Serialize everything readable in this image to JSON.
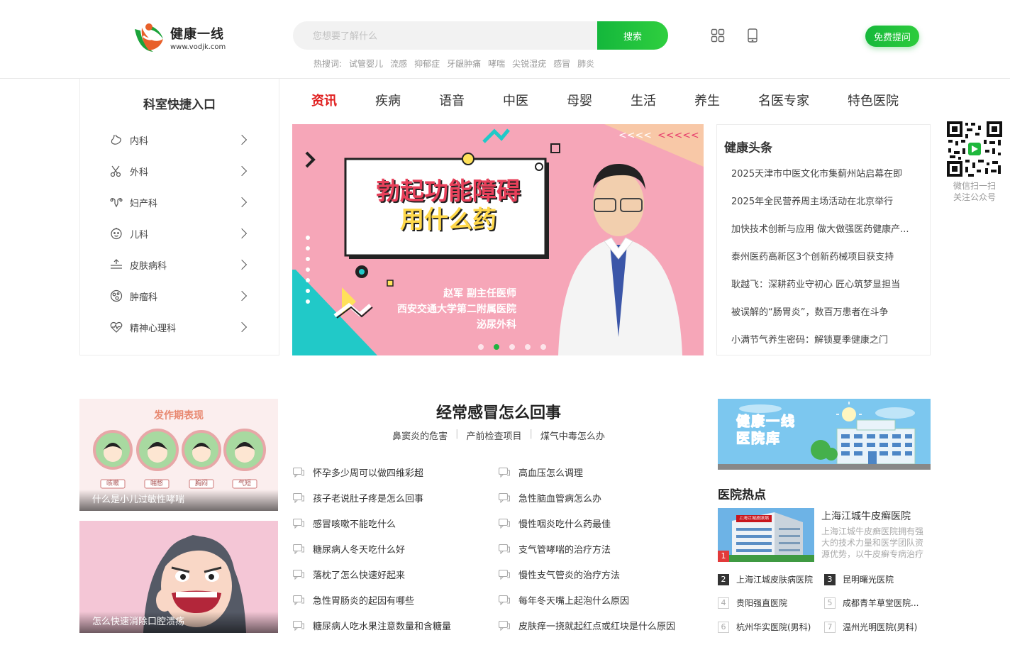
{
  "brand": {
    "name": "健康一线",
    "url": "www.vodjk.com"
  },
  "search": {
    "placeholder": "您想要了解什么",
    "button": "搜索"
  },
  "hot_searches": {
    "label": "热搜词:",
    "terms": [
      "试管婴儿",
      "流感",
      "抑郁症",
      "牙龈肿痛",
      "哮喘",
      "尖锐湿疣",
      "感冒",
      "肺炎"
    ]
  },
  "header": {
    "ask_button": "免费提问"
  },
  "sidebar": {
    "title": "科室快捷入口",
    "items": [
      {
        "label": "内科",
        "icon": "stomach-icon"
      },
      {
        "label": "外科",
        "icon": "scissors-icon"
      },
      {
        "label": "妇产科",
        "icon": "uterus-icon"
      },
      {
        "label": "儿科",
        "icon": "baby-face-icon"
      },
      {
        "label": "皮肤病科",
        "icon": "skin-layers-icon"
      },
      {
        "label": "肿瘤科",
        "icon": "cell-icon"
      },
      {
        "label": "精神心理科",
        "icon": "heartbeat-icon"
      }
    ]
  },
  "nav": {
    "items": [
      "资讯",
      "疾病",
      "语音",
      "中医",
      "母婴",
      "生活",
      "养生",
      "名医专家",
      "特色医院"
    ],
    "active": "资讯"
  },
  "banner": {
    "headline_line1": "勃起功能障碍",
    "headline_line2": "用什么药",
    "doctor": "赵军 副主任医师",
    "hospital": "西安交通大学第二附属医院",
    "department": "泌尿外科",
    "slides": 5,
    "active_slide": 2
  },
  "headlines": {
    "title": "健康头条",
    "items": [
      "2025天津市中医文化市集蓟州站启幕在即",
      "2025年全民营养周主场活动在北京举行",
      "加快技术创新与应用 做大做强医药健康产...",
      "泰州医药高新区3个创新药械项目获支持",
      "耿越飞：深耕药业守初心 匠心筑梦显担当",
      "被误解的“肠胃炎”，数百万患者在斗争",
      "小满节气养生密码：解锁夏季健康之门"
    ]
  },
  "qr": {
    "caption_line1": "微信扫一扫",
    "caption_line2": "关注公众号"
  },
  "thumbs": [
    {
      "caption": "什么是小儿过敏性哮喘",
      "title": "发作期表现",
      "tags": [
        "咳嗽",
        "喘憋",
        "胸闷",
        "气短"
      ]
    },
    {
      "caption": "怎么快速消除口腔溃疡"
    }
  ],
  "topic": {
    "title": "经常感冒怎么回事",
    "links": [
      "鼻窦炎的危害",
      "产前检查项目",
      "煤气中毒怎么办"
    ],
    "left": [
      "怀孕多少周可以做四维彩超",
      "孩子老说肚子疼是怎么回事",
      "感冒咳嗽不能吃什么",
      "糖尿病人冬天吃什么好",
      "落枕了怎么快速好起来",
      "急性胃肠炎的起因有哪些",
      "糖尿病人吃水果注意数量和含糖量"
    ],
    "right": [
      "高血压怎么调理",
      "急性脑血管病怎么办",
      "慢性咽炎吃什么药最佳",
      "支气管哮喘的治疗方法",
      "慢性支气管炎的治疗方法",
      "每年冬天嘴上起泡什么原因",
      "皮肤痒一挠就起红点或红块是什么原因"
    ]
  },
  "hospital_banner": {
    "line1": "健康一线",
    "line2": "医院库"
  },
  "hospital_hot": {
    "title": "医院热点",
    "featured": {
      "rank": "1",
      "name": "上海江城牛皮癣医院",
      "desc": "上海江城牛皮癣医院拥有强大的技术力量和医学团队资源优势，以牛皮癣专病治疗",
      "sign": "上海江城皮肤病医院"
    },
    "ranks": [
      {
        "num": "2",
        "name": "上海江城皮肤病医院"
      },
      {
        "num": "3",
        "name": "昆明曙光医院"
      },
      {
        "num": "4",
        "name": "贵阳强直医院"
      },
      {
        "num": "5",
        "name": "成都青羊草堂医院..."
      },
      {
        "num": "6",
        "name": "杭州华实医院(男科)"
      },
      {
        "num": "7",
        "name": "温州光明医院(男科)"
      }
    ]
  },
  "colors": {
    "brand_green": "#1fb83d",
    "active_red": "#e02020",
    "banner_pink": "#f7a8b8"
  }
}
